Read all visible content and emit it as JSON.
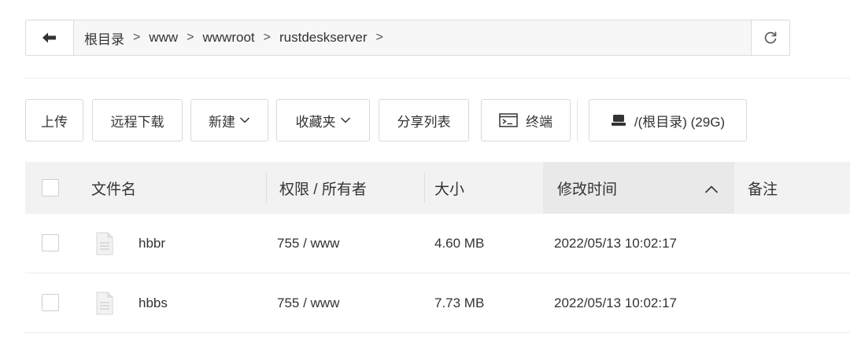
{
  "pathbar": {
    "back_icon": "arrow-left-icon",
    "crumbs": [
      "根目录",
      "www",
      "wwwroot",
      "rustdeskserver"
    ],
    "separator": ">",
    "refresh_icon": "refresh-icon"
  },
  "toolbar": {
    "upload": "上传",
    "remote_download": "远程下载",
    "new": "新建",
    "favorites": "收藏夹",
    "share_list": "分享列表",
    "terminal": "终端",
    "disk": "/(根目录) (29G)"
  },
  "table": {
    "headers": {
      "name": "文件名",
      "perm": "权限 / 所有者",
      "size": "大小",
      "mtime": "修改时间",
      "note": "备注"
    },
    "sort_icon": "chevron-up-icon",
    "rows": [
      {
        "name": "hbbr",
        "perm": "755 / www",
        "size": "4.60 MB",
        "mtime": "2022/05/13 10:02:17",
        "note": ""
      },
      {
        "name": "hbbs",
        "perm": "755 / www",
        "size": "7.73 MB",
        "mtime": "2022/05/13 10:02:17",
        "note": ""
      }
    ]
  },
  "colors": {
    "border": "#dcdcdc",
    "header_bg": "#f2f2f2",
    "text": "#333333"
  }
}
